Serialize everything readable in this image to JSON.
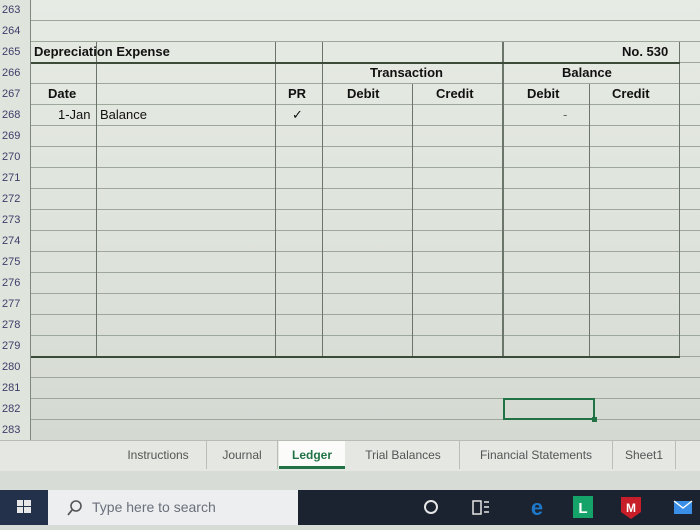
{
  "spreadsheet": {
    "row_numbers": [
      "263",
      "264",
      "265",
      "266",
      "267",
      "268",
      "269",
      "270",
      "271",
      "272",
      "273",
      "274",
      "275",
      "276",
      "277",
      "278",
      "279",
      "280",
      "281",
      "282",
      "283"
    ],
    "account_title": "Depreciation Expense",
    "account_number": "No. 530",
    "group_headers": {
      "transaction": "Transaction",
      "balance": "Balance"
    },
    "column_headers": {
      "date": "Date",
      "pr": "PR",
      "debit": "Debit",
      "credit": "Credit",
      "balance_debit": "Debit",
      "balance_credit": "Credit"
    },
    "entries": [
      {
        "date": "1-Jan",
        "description": "Balance",
        "pr": "✓",
        "balance_debit": "-"
      }
    ]
  },
  "sheet_tabs": [
    {
      "label": "Instructions",
      "active": false
    },
    {
      "label": "Journal",
      "active": false
    },
    {
      "label": "Ledger",
      "active": true
    },
    {
      "label": "Trial Balances",
      "active": false
    },
    {
      "label": "Financial Statements",
      "active": false
    },
    {
      "label": "Sheet1",
      "active": false
    }
  ],
  "taskbar": {
    "search_placeholder": "Type here to search",
    "icons": [
      "windows-start-icon",
      "search-icon",
      "cortana-icon",
      "task-view-icon",
      "edge-icon",
      "lync-icon",
      "mcafee-icon"
    ]
  },
  "colors": {
    "excel_green": "#217346",
    "taskbar": "#1b2230",
    "edge_blue": "#1e78c8",
    "lync_green": "#16a36a",
    "mcafee_red": "#c81e2a"
  }
}
